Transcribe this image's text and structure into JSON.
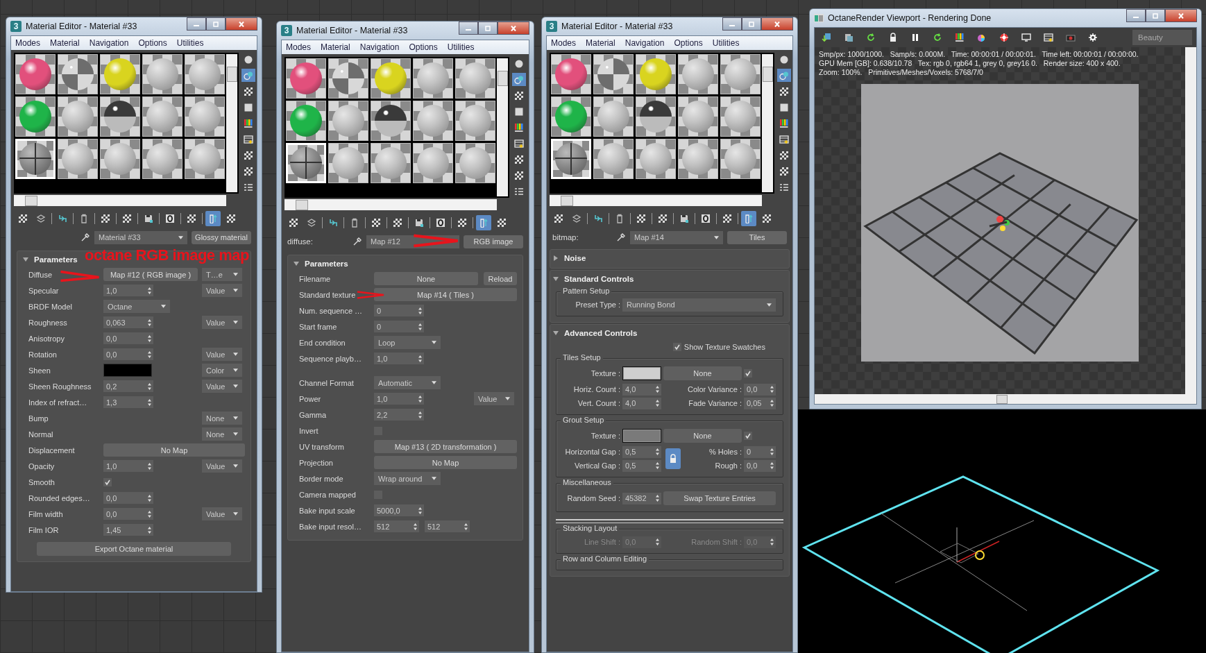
{
  "editors": [
    {
      "kind": "params",
      "logo": "3",
      "title": "Material Editor - Material #33",
      "menu": [
        "Modes",
        "Material",
        "Navigation",
        "Options",
        "Utilities"
      ],
      "slots": [
        {
          "kind": "solid",
          "color": "#e2507c",
          "selected": false
        },
        {
          "kind": "checker",
          "selected": false
        },
        {
          "kind": "solid",
          "color": "#d9d41f",
          "selected": false
        },
        {
          "kind": "plain",
          "selected": false
        },
        {
          "kind": "plain",
          "selected": false
        },
        {
          "kind": "solid",
          "color": "#1fb449",
          "selected": false
        },
        {
          "kind": "plain",
          "selected": false
        },
        {
          "kind": "chrome",
          "selected": false
        },
        {
          "kind": "plain",
          "selected": false
        },
        {
          "kind": "plain",
          "selected": false
        },
        {
          "kind": "tiles",
          "selected": true
        },
        {
          "kind": "plain",
          "selected": false
        },
        {
          "kind": "plain",
          "selected": false
        },
        {
          "kind": "plain",
          "selected": false
        },
        {
          "kind": "plain",
          "selected": false
        }
      ],
      "side_tools": [
        {
          "selected": false
        },
        {
          "selected": true
        },
        {
          "selected": false
        },
        {
          "selected": false
        },
        {
          "selected": false
        },
        {
          "selected": false
        },
        {
          "selected": false
        },
        {
          "selected": false
        },
        {
          "selected": false
        }
      ],
      "tools": [
        {
          "selected": false
        },
        {
          "selected": false
        },
        {
          "selected": false
        },
        {
          "selected": false
        },
        {
          "selected": false
        },
        {
          "selected": false
        },
        {
          "selected": false
        },
        {
          "selected": false
        },
        {
          "selected": false
        },
        {
          "selected": true
        },
        {
          "selected": false
        }
      ],
      "header": {
        "name": "Material #33",
        "name_dropdown": true,
        "type": "Glossy material"
      },
      "rollout": {
        "title": "Parameters",
        "expanded": true,
        "groups": [
          [
            {
              "label": "Diffuse",
              "kind": "map",
              "value": "Map #12 ( RGB image )",
              "mode": "T…e"
            },
            {
              "label": "Specular",
              "kind": "spinner",
              "value": "1,0",
              "mode": "Value"
            },
            {
              "label": "BRDF Model",
              "kind": "dropdown",
              "value": "Octane"
            },
            {
              "label": "Roughness",
              "kind": "spinner",
              "value": "0,063",
              "mode": "Value"
            },
            {
              "label": "Anisotropy",
              "kind": "spinner",
              "value": "0,0"
            },
            {
              "label": "Rotation",
              "kind": "spinner",
              "value": "0,0",
              "mode": "Value"
            },
            {
              "label": "Sheen",
              "kind": "color",
              "color": "#000000",
              "mode": "Color"
            },
            {
              "label": "Sheen Roughness",
              "kind": "spinner",
              "value": "0,2",
              "mode": "Value"
            },
            {
              "label": "Index of refract…",
              "kind": "spinner",
              "value": "1,3"
            },
            {
              "label": "Bump",
              "kind": "none",
              "mode": "None"
            },
            {
              "label": "Normal",
              "kind": "none",
              "mode": "None"
            },
            {
              "label": "Displacement",
              "kind": "map",
              "value": "No Map"
            },
            {
              "label": "Opacity",
              "kind": "spinner",
              "value": "1,0",
              "mode": "Value"
            },
            {
              "label": "Smooth",
              "kind": "checkbox",
              "checked": true
            },
            {
              "label": "Rounded edges…",
              "kind": "spinner",
              "value": "0,0"
            },
            {
              "label": "Film width",
              "kind": "spinner",
              "value": "0,0",
              "mode": "Value"
            },
            {
              "label": "Film IOR",
              "kind": "spinner",
              "value": "1,45"
            }
          ]
        ]
      },
      "footer_button": "Export Octane material",
      "annotation": "octane RGB image map"
    },
    {
      "kind": "params",
      "logo": "3",
      "title": "Material Editor - Material #33",
      "menu": [
        "Modes",
        "Material",
        "Navigation",
        "Options",
        "Utilities"
      ],
      "slots": [
        {
          "kind": "solid",
          "color": "#e2507c",
          "selected": false
        },
        {
          "kind": "checker",
          "selected": false
        },
        {
          "kind": "solid",
          "color": "#d9d41f",
          "selected": false
        },
        {
          "kind": "plain",
          "selected": false
        },
        {
          "kind": "plain",
          "selected": false
        },
        {
          "kind": "solid",
          "color": "#1fb449",
          "selected": false
        },
        {
          "kind": "plain",
          "selected": false
        },
        {
          "kind": "chrome",
          "selected": false
        },
        {
          "kind": "plain",
          "selected": false
        },
        {
          "kind": "plain",
          "selected": false
        },
        {
          "kind": "tiles",
          "selected": true
        },
        {
          "kind": "plain",
          "selected": false
        },
        {
          "kind": "plain",
          "selected": false
        },
        {
          "kind": "plain",
          "selected": false
        },
        {
          "kind": "plain",
          "selected": false
        }
      ],
      "side_tools": [
        {
          "selected": false
        },
        {
          "selected": true
        },
        {
          "selected": false
        },
        {
          "selected": false
        },
        {
          "selected": false
        },
        {
          "selected": false
        },
        {
          "selected": false
        },
        {
          "selected": false
        },
        {
          "selected": false
        }
      ],
      "tools": [
        {
          "selected": false
        },
        {
          "selected": false
        },
        {
          "selected": false
        },
        {
          "selected": false
        },
        {
          "selected": false
        },
        {
          "selected": false
        },
        {
          "selected": false
        },
        {
          "selected": false
        },
        {
          "selected": false
        },
        {
          "selected": true
        },
        {
          "selected": false
        }
      ],
      "header": {
        "label": "diffuse:",
        "name": "Map #12",
        "name_dropdown": false,
        "type": "RGB image"
      },
      "rollout": {
        "title": "Parameters",
        "expanded": true,
        "groups": [
          [
            {
              "label": "Filename",
              "kind": "file",
              "value": "None",
              "extra": "Reload"
            },
            {
              "label": "Standard texture",
              "kind": "map",
              "value": "Map #14 ( Tiles )"
            },
            {
              "label": "Num. sequence …",
              "kind": "spinner",
              "value": "0"
            },
            {
              "label": "Start frame",
              "kind": "spinner",
              "value": "0"
            },
            {
              "label": "End condition",
              "kind": "dropdown",
              "value": "Loop"
            },
            {
              "label": "Sequence playb…",
              "kind": "spinner",
              "value": "1,0"
            }
          ],
          [
            {
              "label": "Channel Format",
              "kind": "dropdown",
              "value": "Automatic"
            },
            {
              "label": "Power",
              "kind": "spinner",
              "value": "1,0",
              "mode": "Value"
            },
            {
              "label": "Gamma",
              "kind": "spinner",
              "value": "2,2"
            },
            {
              "label": "Invert",
              "kind": "checkbox",
              "checked": false
            },
            {
              "label": "UV transform",
              "kind": "map",
              "value": "Map #13 ( 2D transformation )"
            },
            {
              "label": "Projection",
              "kind": "map",
              "value": "No Map"
            },
            {
              "label": "Border mode",
              "kind": "dropdown",
              "value": "Wrap around"
            },
            {
              "label": "Camera mapped",
              "kind": "checkbox",
              "checked": false
            },
            {
              "label": "Bake input scale",
              "kind": "spinner",
              "value": "5000,0"
            },
            {
              "label": "Bake input resol…",
              "kind": "spinner",
              "value": "512",
              "value2": "512"
            }
          ]
        ]
      }
    },
    {
      "kind": "tiles",
      "logo": "3",
      "title": "Material Editor - Material #33",
      "menu": [
        "Modes",
        "Material",
        "Navigation",
        "Options",
        "Utilities"
      ],
      "slots": [
        {
          "kind": "solid",
          "color": "#e2507c",
          "selected": false
        },
        {
          "kind": "checker",
          "selected": false
        },
        {
          "kind": "solid",
          "color": "#d9d41f",
          "selected": false
        },
        {
          "kind": "plain",
          "selected": false
        },
        {
          "kind": "plain",
          "selected": false
        },
        {
          "kind": "solid",
          "color": "#1fb449",
          "selected": false
        },
        {
          "kind": "plain",
          "selected": false
        },
        {
          "kind": "chrome",
          "selected": false
        },
        {
          "kind": "plain",
          "selected": false
        },
        {
          "kind": "plain",
          "selected": false
        },
        {
          "kind": "tiles",
          "selected": true
        },
        {
          "kind": "plain",
          "selected": false
        },
        {
          "kind": "plain",
          "selected": false
        },
        {
          "kind": "plain",
          "selected": false
        },
        {
          "kind": "plain",
          "selected": false
        }
      ],
      "side_tools": [
        {
          "selected": false
        },
        {
          "selected": true
        },
        {
          "selected": false
        },
        {
          "selected": false
        },
        {
          "selected": false
        },
        {
          "selected": false
        },
        {
          "selected": false
        },
        {
          "selected": false
        },
        {
          "selected": false
        }
      ],
      "tools": [
        {
          "selected": false
        },
        {
          "selected": false
        },
        {
          "selected": false
        },
        {
          "selected": false
        },
        {
          "selected": false
        },
        {
          "selected": false
        },
        {
          "selected": false
        },
        {
          "selected": false
        },
        {
          "selected": false
        },
        {
          "selected": true
        },
        {
          "selected": false
        }
      ],
      "header": {
        "label": "bitmap:",
        "name": "Map #14",
        "name_dropdown": true,
        "type": "Tiles"
      },
      "rollouts": [
        {
          "title": "Noise",
          "expanded": false
        },
        {
          "title": "Standard Controls",
          "expanded": true,
          "items": [
            {
              "kind": "group",
              "title": "Pattern Setup",
              "disabled": false,
              "rows": [
                [
                  {
                    "kind": "label",
                    "text": "Preset Type :"
                  },
                  {
                    "kind": "dropdown",
                    "value": "Running Bond"
                  }
                ]
              ]
            }
          ]
        },
        {
          "title": "Advanced Controls",
          "expanded": true,
          "items": [
            {
              "kind": "check",
              "label": "Show Texture Swatches",
              "checked": true
            },
            {
              "kind": "group",
              "title": "Tiles Setup",
              "disabled": false,
              "rows": [
                [
                  {
                    "kind": "label",
                    "text": "Texture :"
                  },
                  {
                    "kind": "swatch",
                    "color": "#cfcfcf"
                  },
                  {
                    "kind": "button",
                    "text": "None"
                  },
                  {
                    "kind": "check",
                    "checked": true
                  }
                ],
                [
                  {
                    "kind": "label",
                    "text": "Horiz. Count :"
                  },
                  {
                    "kind": "spinner",
                    "value": "4,0"
                  },
                  {
                    "kind": "label",
                    "text": "Color Variance :"
                  },
                  {
                    "kind": "spinner",
                    "value": "0,0"
                  }
                ],
                [
                  {
                    "kind": "label",
                    "text": "Vert. Count :"
                  },
                  {
                    "kind": "spinner",
                    "value": "4,0"
                  },
                  {
                    "kind": "label",
                    "text": "Fade Variance :"
                  },
                  {
                    "kind": "spinner",
                    "value": "0,05"
                  }
                ]
              ]
            },
            {
              "kind": "group",
              "title": "Grout Setup",
              "disabled": false,
              "lock": {
                "on": true
              },
              "rows": [
                [
                  {
                    "kind": "label",
                    "text": "Texture :"
                  },
                  {
                    "kind": "swatch",
                    "color": "#7a7a7a"
                  },
                  {
                    "kind": "button",
                    "text": "None"
                  },
                  {
                    "kind": "check",
                    "checked": true
                  }
                ],
                [
                  {
                    "kind": "label",
                    "text": "Horizontal Gap :"
                  },
                  {
                    "kind": "spinner",
                    "value": "0,5"
                  },
                  {
                    "kind": "label",
                    "text": "% Holes :"
                  },
                  {
                    "kind": "spinner",
                    "value": "0"
                  }
                ],
                [
                  {
                    "kind": "label",
                    "text": "Vertical Gap :"
                  },
                  {
                    "kind": "spinner",
                    "value": "0,5"
                  },
                  {
                    "kind": "label",
                    "text": "Rough :"
                  },
                  {
                    "kind": "spinner",
                    "value": "0,0"
                  }
                ]
              ]
            },
            {
              "kind": "group",
              "title": "Miscellaneous",
              "disabled": false,
              "rows": [
                [
                  {
                    "kind": "label",
                    "text": "Random Seed :"
                  },
                  {
                    "kind": "spinner",
                    "value": "45382"
                  },
                  {
                    "kind": "button",
                    "text": "Swap Texture Entries"
                  }
                ]
              ]
            },
            {
              "kind": "rule"
            },
            {
              "kind": "group",
              "title": "Stacking Layout",
              "disabled": true,
              "rows": [
                [
                  {
                    "kind": "label",
                    "text": "Line Shift :"
                  },
                  {
                    "kind": "spinner",
                    "value": "0,0"
                  },
                  {
                    "kind": "label",
                    "text": "Random Shift :"
                  },
                  {
                    "kind": "spinner",
                    "value": "0,0"
                  }
                ]
              ]
            },
            {
              "kind": "group",
              "title": "Row and Column Editing",
              "disabled": false
            }
          ]
        }
      ]
    }
  ],
  "viewport": {
    "title": "OctaneRender Viewport - Rendering Done",
    "render_pass": "Beauty",
    "status_lines": [
      "Smp/px: 1000/1000.   Samp/s: 0.000M.   Time: 00:00:01 / 00:00:01.   Time left: 00:00:01 / 00:00:00.",
      "GPU Mem [GB]: 0.638/10.78   Tex: rgb 0, rgb64 1, grey 0, grey16 0.   Render size: 400 x 400.",
      "Zoom: 100%.   Primitives/Meshes/Voxels: 5768/7/0"
    ]
  }
}
